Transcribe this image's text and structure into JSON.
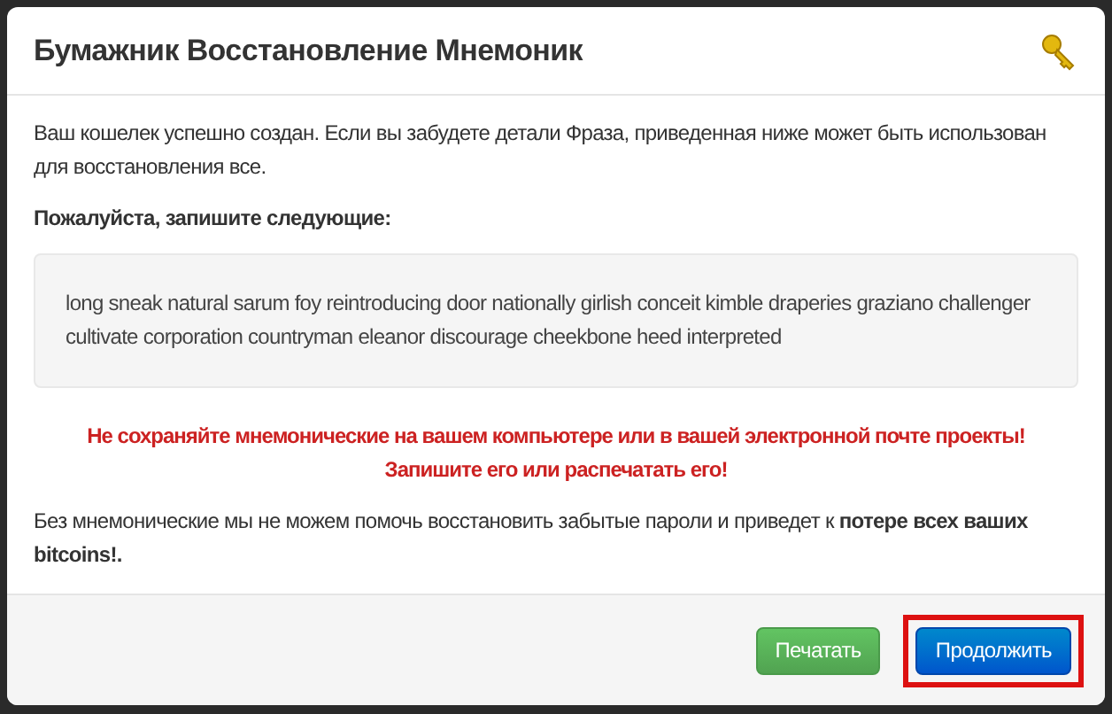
{
  "dialog": {
    "title": "Бумажник Восстановление Мнемоник",
    "intro": "Ваш кошелек успешно создан. Если вы забудете детали Фраза, приведенная ниже может быть использован для восстановления все.",
    "instruction": "Пожалуйста, запишите следующие:",
    "mnemonic": "long sneak natural sarum foy reintroducing door nationally girlish conceit kimble draperies graziano challenger cultivate corporation countryman eleanor discourage cheekbone heed interpreted",
    "warnings": [
      "Не сохраняйте мнемонические на вашем компьютере или в вашей электронной почте проекты!",
      "Запишите его или распечатать его!"
    ],
    "note": "Без мнемонические мы не можем помочь восстановить забытые пароли и приведет к **потере всех ваших bitcoins!.**",
    "buttons": [
      {
        "label": "Печатать",
        "kind": "success",
        "highlighted": false
      },
      {
        "label": "Продолжить",
        "kind": "primary",
        "highlighted": true
      }
    ]
  }
}
